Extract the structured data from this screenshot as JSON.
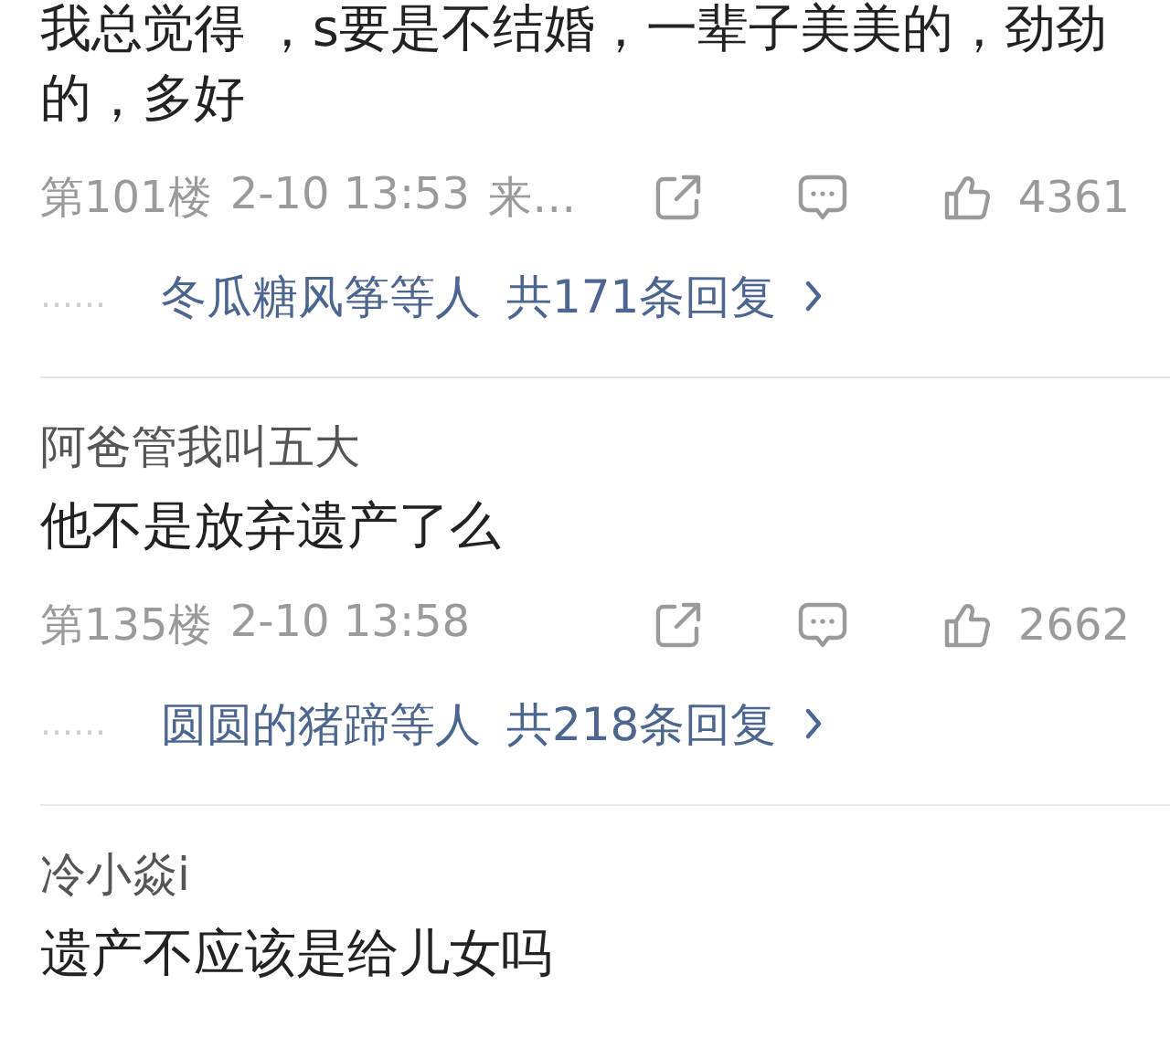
{
  "comments": [
    {
      "text": "我总觉得 ，s要是不结婚，一辈子美美的，劲劲的，多好",
      "floor": "第101楼",
      "time": "2-10 13:53",
      "source": "来…",
      "likes": "4361",
      "replies": {
        "prefix": "……",
        "names": "冬瓜糖风筝等人",
        "count": "共171条回复"
      }
    },
    {
      "author": "阿爸管我叫五大",
      "text": "他不是放弃遗产了么",
      "floor": "第135楼",
      "time": "2-10 13:58",
      "likes": "2662",
      "replies": {
        "prefix": "……",
        "names": "圆圆的猪蹄等人",
        "count": "共218条回复"
      }
    },
    {
      "author": "冷小焱i",
      "text": "遗产不应该是给儿女吗"
    }
  ]
}
